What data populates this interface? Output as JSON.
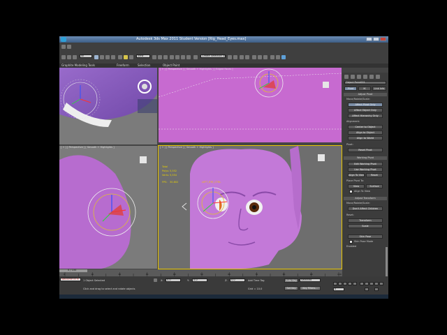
{
  "window": {
    "title": "Autodesk 3ds Max 2011   Student Version   [Rig_Head_Eyes.max]"
  },
  "menubar": {
    "items": [
      "Graphite Modeling Tools",
      "Freeform",
      "Selection",
      "Object Paint"
    ]
  },
  "toolbar": {
    "selection_filter": "All",
    "named_selection": "Create Selection Se",
    "view": "View"
  },
  "viewports": {
    "top_left": "[ + ] [ Perspective ] [ Smooth + Highlights ]",
    "top_right": "[ + ] [ Perspective ] [ Smooth + Highlights ] [ Edged Faces ]",
    "bottom_left": "[ + ] [ Perspective ] [ Smooth + Highlights ]",
    "bottom_right": "[ + ] [ Perspective ] [ Smooth + Highlights ]",
    "stats": {
      "header": "Total",
      "polys_label": "Polys:",
      "polys": "5,552",
      "verts_label": "Verts:",
      "verts": "5,554",
      "fps_label": "FPS:",
      "fps": "30.802"
    },
    "overlay_tag": "LEFT_EYE_CTRL"
  },
  "command_panel": {
    "object_name": "Object Point001",
    "tabs": [
      "Pivot",
      "IK",
      "Link Info"
    ],
    "adjust_pivot": {
      "title": "Adjust Pivot",
      "section": "Move/Rotate/Scale:",
      "buttons": [
        "Affect Pivot Only",
        "Affect Object Only",
        "Affect Hierarchy Only"
      ],
      "alignment_label": "Alignment:",
      "alignment_buttons": [
        "Center to Object",
        "Align to Object",
        "Align to World"
      ],
      "pivot_label": "Pivot:",
      "reset_button": "Reset Pivot"
    },
    "working_pivot": {
      "title": "Working Pivot",
      "buttons": [
        "Edit Working Pivot",
        "Use Working Pivot",
        "Align To View",
        "Reset"
      ],
      "place_label": "Place Pivot To:",
      "place_options": [
        "View",
        "Surface"
      ],
      "align_checkbox": "Align To View"
    },
    "adjust_transform": {
      "title": "Adjust Transform",
      "section": "Move/Rotate/Scale:",
      "dont_affect": "Don't Affect Children",
      "reset_label": "Reset:",
      "reset_buttons": [
        "Transform",
        "Scale"
      ],
      "skin_pose": "Skin Pose",
      "skin_checkbox": "Skin Pose Mode",
      "enabled": "Enabled"
    }
  },
  "timeline": {
    "frame_display": "0 / 100",
    "ticks": [
      "0",
      "10",
      "20",
      "30",
      "40",
      "50",
      "60",
      "70",
      "80",
      "90",
      "100"
    ]
  },
  "status": {
    "selection": "1 Object Selected",
    "prompt": "Click and drag to select and rotate objects",
    "x_label": "X:",
    "x_value": "0.0",
    "y_label": "Y:",
    "y_value": "0.0",
    "z_label": "Z:",
    "z_value": "0.0",
    "grid_label": "Grid = 10.0",
    "auto_key": "Auto Key",
    "selected": "Selected",
    "set_key": "Set Key",
    "key_filters": "Key Filters...",
    "welcome": "Welcome to M",
    "add_time_tag": "Add Time Tag",
    "frame_field": "0"
  }
}
